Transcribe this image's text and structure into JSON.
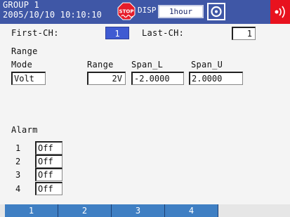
{
  "header": {
    "group_label": "GROUP 1",
    "datetime": "2005/10/10 10:10:10",
    "stop_icon_text": "STOP",
    "disp_label": "DISP",
    "timescale": "1hour"
  },
  "channels": {
    "first_label": "First-CH:",
    "first_value": "1",
    "last_label": "Last-CH:",
    "last_value": "1"
  },
  "range": {
    "section_label": "Range",
    "mode_label": "Mode",
    "mode_value": "Volt",
    "range_label": "Range",
    "range_value": "2V",
    "span_l_label": "Span_L",
    "span_l_value": "-2.0000",
    "span_u_label": "Span_U",
    "span_u_value": "2.0000"
  },
  "alarm": {
    "section_label": "Alarm",
    "items": [
      {
        "num": "1",
        "value": "Off"
      },
      {
        "num": "2",
        "value": "Off"
      },
      {
        "num": "3",
        "value": "Off"
      },
      {
        "num": "4",
        "value": "Off"
      }
    ]
  },
  "softkeys": [
    "1",
    "2",
    "3",
    "4"
  ],
  "colors": {
    "header_bg": "#3f57a6",
    "selected_field": "#3f5bd2",
    "softkey_bg": "#3f7fc3",
    "alarm_indicator": "#e8121e"
  },
  "icons": [
    "stop-icon",
    "camera-icon",
    "alarm-indicator-icon"
  ]
}
